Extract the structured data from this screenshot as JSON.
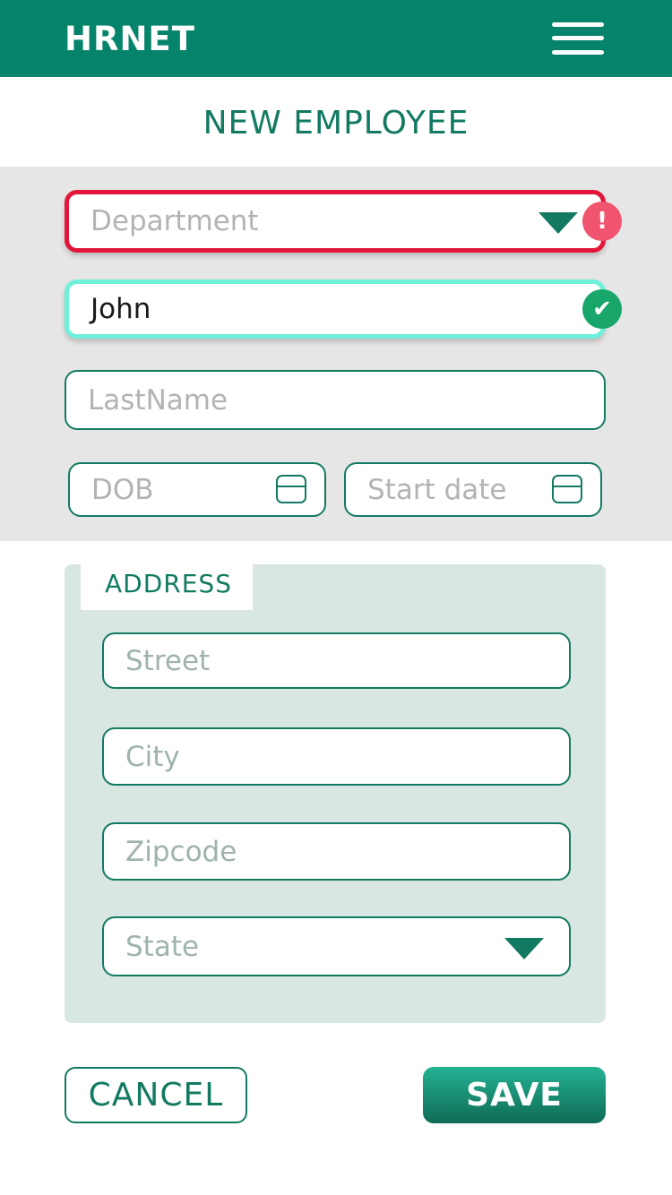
{
  "header": {
    "logo": "HRNET",
    "menu_icon": "hamburger-menu-icon"
  },
  "page": {
    "title": "NEW EMPLOYEE"
  },
  "form": {
    "department": {
      "placeholder": "Department",
      "status": "error",
      "status_glyph": "!"
    },
    "first_name": {
      "value": "John",
      "status": "valid",
      "status_glyph": "✔"
    },
    "last_name": {
      "placeholder": "LastName"
    },
    "dob": {
      "placeholder": "DOB"
    },
    "start_date": {
      "placeholder": "Start date"
    }
  },
  "address": {
    "label": "ADDRESS",
    "street": {
      "placeholder": "Street"
    },
    "city": {
      "placeholder": "City"
    },
    "zipcode": {
      "placeholder": "Zipcode"
    },
    "state": {
      "placeholder": "State"
    }
  },
  "actions": {
    "cancel_label": "CANCEL",
    "save_label": "SAVE"
  },
  "colors": {
    "brand": "#05836b",
    "accent_text": "#137a62",
    "error": "#e1163a",
    "valid_border": "#6ef0da",
    "valid_icon": "#18a66a",
    "panel_gray": "#e6e6e6",
    "address_bg": "#d9e7e3"
  }
}
